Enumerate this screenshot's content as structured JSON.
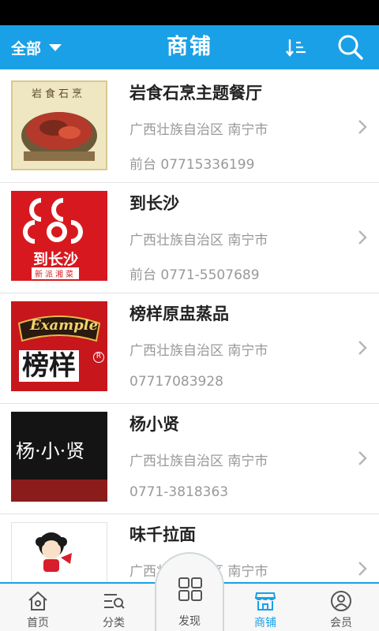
{
  "header": {
    "filter_label": "全部",
    "title": "商铺"
  },
  "shops": [
    {
      "name": "岩食石烹主题餐厅",
      "region": "广西壮族自治区 南宁市",
      "phone": "前台 07715336199",
      "logo_text": "岩食石烹"
    },
    {
      "name": "到长沙",
      "region": "广西壮族自治区 南宁市",
      "phone": "前台 0771-5507689",
      "logo_text": "到长沙",
      "logo_subtext": "新派湘菜"
    },
    {
      "name": "榜样原盅蒸品",
      "region": "广西壮族自治区 南宁市",
      "phone": "07717083928",
      "logo_text": "榜样",
      "logo_brand": "Example"
    },
    {
      "name": "杨小贤",
      "region": "广西壮族自治区 南宁市",
      "phone": "0771-3818363",
      "logo_text": "杨·小·贤"
    },
    {
      "name": "味千拉面",
      "region": "广西壮族自治区 南宁市",
      "phone": ""
    }
  ],
  "tabs": [
    {
      "label": "首页",
      "icon": "home-icon",
      "active": false
    },
    {
      "label": "分类",
      "icon": "category-icon",
      "active": false
    },
    {
      "label": "发现",
      "icon": "grid-icon",
      "active": false
    },
    {
      "label": "商铺",
      "icon": "shop-icon",
      "active": true
    },
    {
      "label": "会员",
      "icon": "user-icon",
      "active": false
    }
  ],
  "colors": {
    "accent": "#1aa0e6",
    "muted": "#999999"
  }
}
